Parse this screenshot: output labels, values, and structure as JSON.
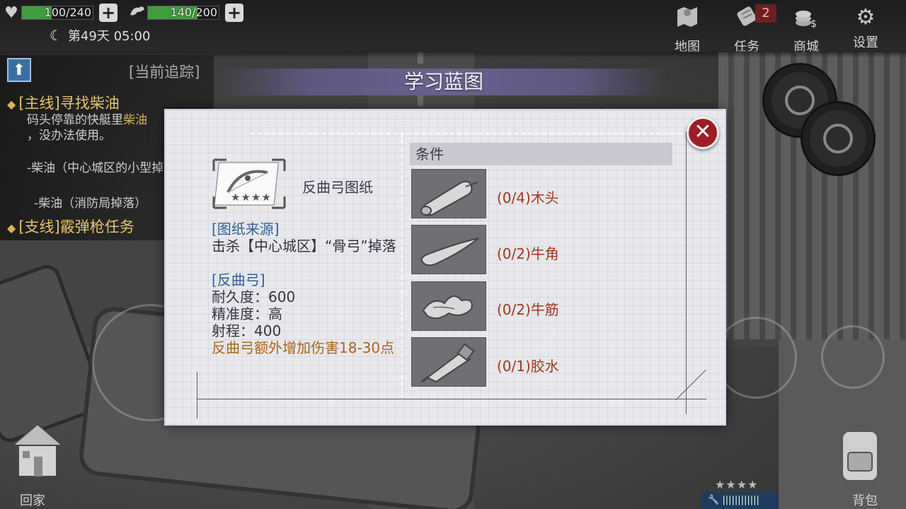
{
  "hud": {
    "health": {
      "icon": "heart-icon",
      "value_text": "100/240",
      "fraction": 0.42
    },
    "stamina": {
      "icon": "arm-icon",
      "value_text": "140/200",
      "fraction": 0.7
    },
    "day_time": "第49天 05:00",
    "nav": [
      {
        "label": "地图",
        "icon": "map-icon"
      },
      {
        "label": "任务",
        "icon": "scroll-icon",
        "badge": "2"
      },
      {
        "label": "商城",
        "icon": "coins-icon"
      },
      {
        "label": "设置",
        "icon": "gear-icon"
      }
    ]
  },
  "tracker": {
    "title": "[当前追踪]",
    "main_quest": "[主线]寻找柴油",
    "desc_a": "码头停靠的快艇里",
    "desc_hl": "柴油",
    "desc_b": "，没办法使用。",
    "sub1": "-柴油（中心城区的小型掉落）",
    "sub2": "-柴油（消防局掉落）",
    "side_quest": "[支线]霰弹枪任务"
  },
  "bottom": {
    "home": "回家",
    "bag": "背包",
    "weapon_stars": "★★★★"
  },
  "dialog": {
    "title": "学习蓝图",
    "blueprint_name": "反曲弓图纸",
    "blueprint_stars": "★★★★",
    "source_header": "[图纸来源]",
    "source_text": "击杀【中心城区】“骨弓”掉落",
    "item_header": "[反曲弓]",
    "durability": "耐久度：600",
    "accuracy": "精准度：高",
    "range": "射程：400",
    "bonus": "反曲弓额外增加伤害18-30点",
    "conditions_header": "条件",
    "materials": [
      {
        "label": "(0/4)木头",
        "icon": "wood-log-icon"
      },
      {
        "label": "(0/2)牛角",
        "icon": "ox-horn-icon"
      },
      {
        "label": "(0/2)牛筋",
        "icon": "ox-tendon-icon"
      },
      {
        "label": "(0/1)胶水",
        "icon": "glue-tube-icon"
      }
    ],
    "close_symbol": "✕"
  }
}
